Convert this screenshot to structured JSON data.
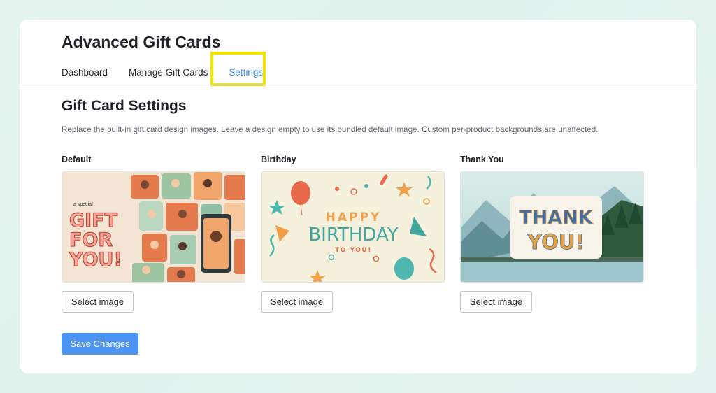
{
  "app": {
    "title": "Advanced Gift Cards"
  },
  "tabs": [
    {
      "label": "Dashboard"
    },
    {
      "label": "Manage Gift Cards"
    },
    {
      "label": "Settings",
      "active": true
    }
  ],
  "settings": {
    "title": "Gift Card Settings",
    "description": "Replace the built-in gift card design images. Leave a design empty to use its bundled default image. Custom per-product backgrounds are unaffected."
  },
  "designs": [
    {
      "label": "Default",
      "button": "Select image",
      "art": {
        "line1": "a special",
        "line2": "GIFT",
        "line3": "FOR",
        "line4": "YOU!"
      }
    },
    {
      "label": "Birthday",
      "button": "Select image",
      "art": {
        "line1": "HAPPY",
        "line2": "BIRTHDAY",
        "line3": "TO YOU!"
      }
    },
    {
      "label": "Thank You",
      "button": "Select image",
      "art": {
        "line1": "THANK",
        "line2": "YOU!"
      }
    }
  ],
  "actions": {
    "save": "Save Changes"
  },
  "colors": {
    "accent": "#3c8ff0",
    "save_button": "#4b93f2",
    "highlight": "#f2e600"
  }
}
